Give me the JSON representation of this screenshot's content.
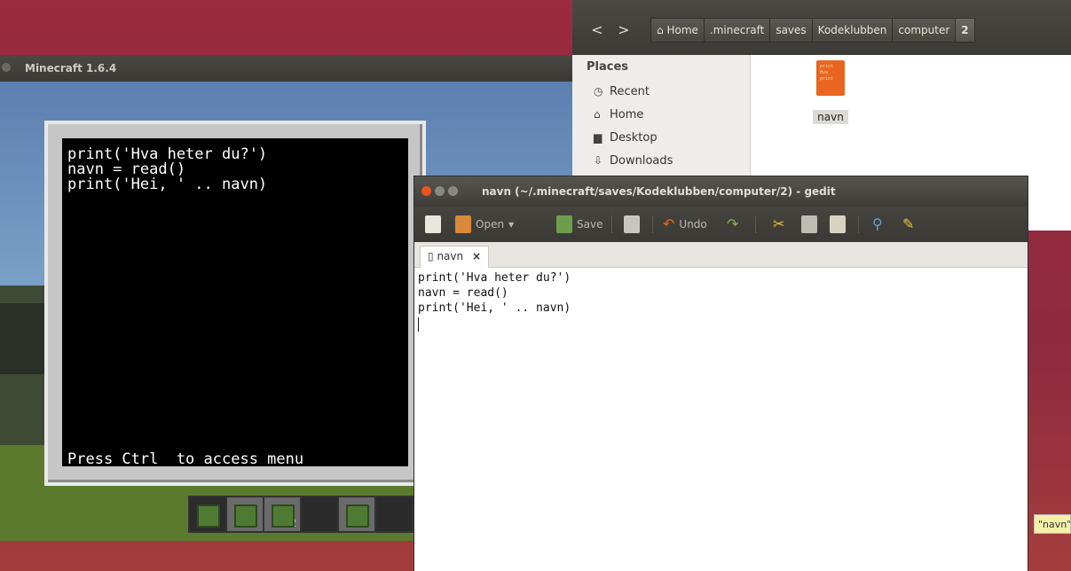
{
  "minecraft": {
    "window_title": "Minecraft 1.6.4",
    "terminal_lines": [
      "print('Hva heter du?')",
      "navn = read()",
      "print('Hei, ' .. navn)"
    ],
    "terminal_footer": "Press Ctrl  to access menu",
    "hotbar_slot_count": "2"
  },
  "file_manager": {
    "nav": {
      "back": "<",
      "forward": ">"
    },
    "breadcrumbs": [
      "Home",
      ".minecraft",
      "saves",
      "Kodeklubben",
      "computer",
      "2"
    ],
    "sidebar": {
      "heading": "Places",
      "items": [
        {
          "icon": "clock-icon",
          "label": "Recent"
        },
        {
          "icon": "home-icon",
          "label": "Home"
        },
        {
          "icon": "folder-icon",
          "label": "Desktop"
        },
        {
          "icon": "download-icon",
          "label": "Downloads"
        }
      ]
    },
    "files": [
      {
        "name": "navn",
        "preview": [
          "print",
          "Hva",
          "print"
        ]
      }
    ]
  },
  "gedit": {
    "window_title": "navn (~/.minecraft/saves/Kodeklubben/computer/2) - gedit",
    "toolbar": {
      "open_label": "Open",
      "save_label": "Save",
      "undo_label": "Undo"
    },
    "tab_label": "navn",
    "tab_close": "×",
    "lines": [
      "print('Hva heter du?')",
      "navn = read()",
      "print('Hei, ' .. navn)"
    ]
  },
  "tooltip": {
    "text": "\"navn\""
  },
  "colors": {
    "accent_orange": "#e8551c",
    "terminal_bg": "#000000",
    "file_icon": "#e8661f"
  }
}
